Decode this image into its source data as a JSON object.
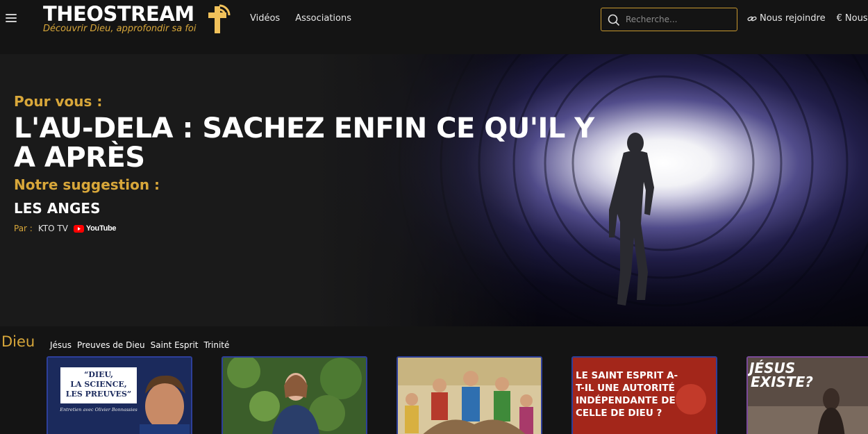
{
  "header": {
    "logo_title": "THEOSTREAM",
    "logo_tagline": "Découvrir Dieu, approfondir sa foi",
    "nav": [
      "Vidéos",
      "Associations"
    ],
    "search_placeholder": "Recherche...",
    "right_links": [
      "Nous rejoindre",
      "Nous s"
    ]
  },
  "hero": {
    "for_you_label": "Pour vous :",
    "title": "L'AU-DELA : SACHEZ ENFIN CE QU'IL Y A APRÈS",
    "suggestion_label": "Notre suggestion :",
    "suggestion_title": "LES ANGES",
    "by_prefix": "Par :",
    "channel": "KTO TV",
    "platform": "YouTube"
  },
  "category": {
    "title": "Dieu",
    "tags": [
      "Jésus",
      "Preuves de Dieu",
      "Saint Esprit",
      "Trinité"
    ]
  },
  "cards": [
    {
      "text_lines": [
        "“DIEU,",
        "LA SCIENCE,",
        "LES PREUVES”"
      ],
      "subtitle": "Entretien avec Olivier Bonnassies"
    },
    {
      "text_lines": []
    },
    {
      "text_lines": []
    },
    {
      "text_lines": [
        "LE SAINT ESPRIT A-",
        "T-IL UNE AUTORITÉ",
        "INDÉPENDANTE DE",
        "CELLE DE DIEU ?"
      ]
    },
    {
      "text_lines": [
        "JÉSUS",
        "EXISTE?"
      ]
    }
  ],
  "colors": {
    "gold": "#d8a73a",
    "background": "#141414",
    "card_border": "#2d3f9a"
  }
}
